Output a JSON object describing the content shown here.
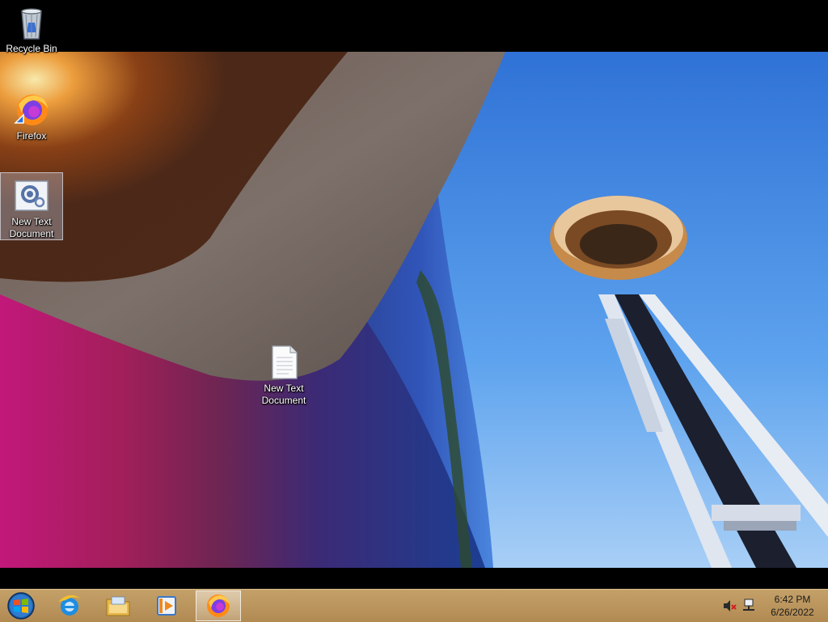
{
  "desktop": {
    "icons": {
      "recycle_bin": "Recycle Bin",
      "firefox": "Firefox",
      "new_text_document_1": "New Text\nDocument",
      "new_text_document_2": "New Text\nDocument"
    }
  },
  "taskbar": {
    "pinned": [
      {
        "icon": "internet-explorer-icon"
      },
      {
        "icon": "file-explorer-icon"
      },
      {
        "icon": "media-player-icon"
      },
      {
        "icon": "firefox-icon",
        "active": true
      }
    ],
    "tray": {
      "volume_icon": "volume-muted-icon",
      "network_icon": "network-icon"
    },
    "clock": {
      "time": "6:42 PM",
      "date": "6/26/2022"
    }
  },
  "colors": {
    "taskbar": "#b99559",
    "sky": "#3f86e3"
  }
}
